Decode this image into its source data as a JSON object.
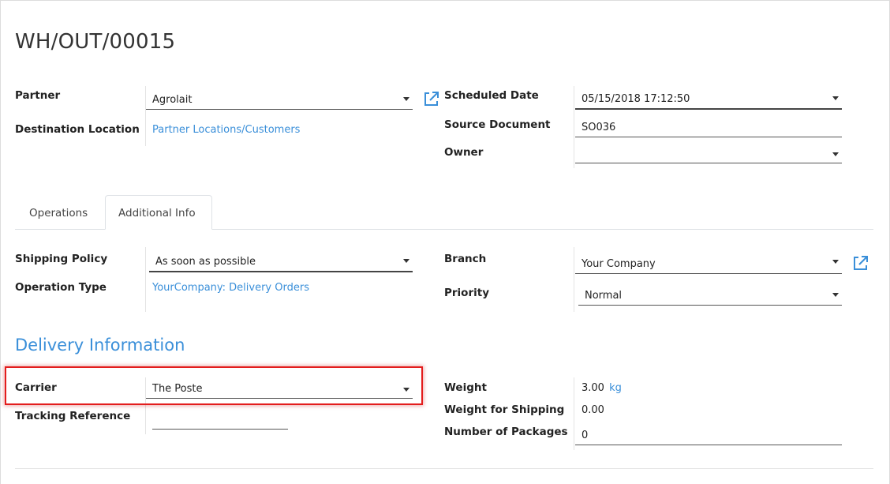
{
  "record": {
    "title": "WH/OUT/00015"
  },
  "header_left": {
    "partner_label": "Partner",
    "partner_value": "Agrolait",
    "destination_label": "Destination Location",
    "destination_value": "Partner Locations/Customers"
  },
  "header_right": {
    "scheduled_label": "Scheduled Date",
    "scheduled_value": "05/15/2018 17:12:50",
    "source_label": "Source Document",
    "source_value": "SO036",
    "owner_label": "Owner",
    "owner_value": ""
  },
  "tabs": [
    {
      "label": "Operations",
      "active": false
    },
    {
      "label": "Additional Info",
      "active": true
    }
  ],
  "info_left": {
    "shipping_label": "Shipping Policy",
    "shipping_value": "As soon as possible",
    "optype_label": "Operation Type",
    "optype_value": "YourCompany: Delivery Orders"
  },
  "info_right": {
    "branch_label": "Branch",
    "branch_value": "Your Company",
    "priority_label": "Priority",
    "priority_value": "Normal"
  },
  "delivery": {
    "section_title": "Delivery Information",
    "carrier_label": "Carrier",
    "carrier_value": "The Poste",
    "tracking_label": "Tracking Reference",
    "tracking_value": "",
    "weight_label": "Weight",
    "weight_value": "3.00",
    "weight_unit": "kg",
    "weight_shipping_label": "Weight for Shipping",
    "weight_shipping_value": "0.00",
    "packages_label": "Number of Packages",
    "packages_value": "0"
  },
  "colors": {
    "link": "#3a8fd9",
    "highlight": "#e31c1c"
  },
  "icons": {
    "external": "external-link-icon",
    "dropdown": "caret-down-icon"
  }
}
